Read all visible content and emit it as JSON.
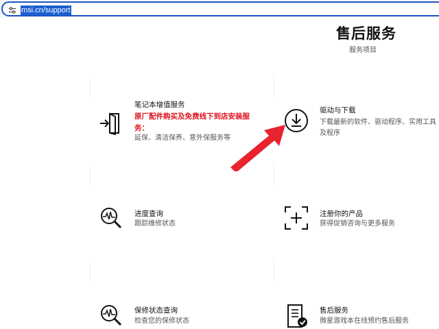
{
  "browser": {
    "url": "msi.cn/support"
  },
  "header": {
    "title": "售后服务",
    "subtitle": "服务项目"
  },
  "services": {
    "notebook": {
      "title": "笔记本增值服务",
      "highlight_line1": "原厂配件购买及免费线下到店安装服",
      "highlight_line2": "务：",
      "desc": "延保、清洁保养、意外保服务等",
      "icon": "login-door-icon"
    },
    "drivers": {
      "title": "驱动与下载",
      "desc_line1": "下载最新的软件、驱动程序、实用工具",
      "desc_line2": "及程序",
      "icon": "download-icon"
    },
    "progress": {
      "title": "进度查询",
      "desc": "跟踪维修状态",
      "icon": "search-pulse-icon"
    },
    "register": {
      "title": "注册你的产品",
      "desc": "获得促销咨询与更多服务",
      "icon": "add-frame-icon"
    },
    "warranty": {
      "title": "保修状态查询",
      "desc": "检查您的保修状态",
      "icon": "search-pulse-icon"
    },
    "aftersales": {
      "title": "售后服务",
      "desc": "微星游戏本在线预约售后服务",
      "icon": "document-check-icon"
    }
  },
  "annotation": {
    "arrow_color": "#e8232e"
  }
}
